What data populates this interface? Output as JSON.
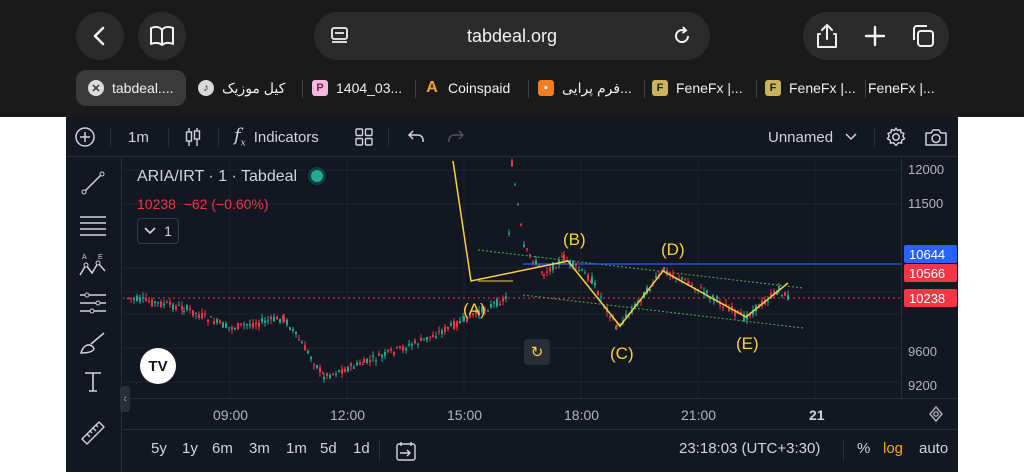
{
  "browser": {
    "url": "tabdeal.org",
    "tabs": [
      {
        "label": "tabdeal....",
        "active": true,
        "icon": "close-icon"
      },
      {
        "label": "کیل موزیک",
        "icon": "music-icon"
      },
      {
        "label": "1404_03...",
        "icon": "p-icon"
      },
      {
        "label": "Coinspaid",
        "icon": "coinspaid-icon"
      },
      {
        "label": "فرم پرایی...",
        "icon": "form-icon"
      },
      {
        "label": "FeneFx |...",
        "icon": "fenefx-icon"
      },
      {
        "label": "FeneFx |...",
        "icon": "fenefx-icon"
      },
      {
        "label": "FeneFx |...",
        "icon": "fenefx-icon"
      }
    ]
  },
  "toolbar": {
    "interval": "1m",
    "indicators": "Indicators",
    "layout_name": "Unnamed"
  },
  "legend": {
    "symbol": "ARIA/IRT · 1 · Tabdeal",
    "last_price": "10238",
    "change": "−62 (−0.60%)",
    "collapse_count": "1"
  },
  "price_axis": {
    "labels": [
      "12000",
      "11500",
      "9600",
      "9200"
    ],
    "tags": [
      {
        "value": "10644",
        "color": "#2962ff"
      },
      {
        "value": "10566",
        "color": "#f23645"
      },
      {
        "value": "10238",
        "color": "#f23645"
      }
    ]
  },
  "time_axis": {
    "labels": [
      "09:00",
      "12:00",
      "15:00",
      "18:00",
      "21:00",
      "21"
    ]
  },
  "waves": [
    "(A)",
    "(B)",
    "(C)",
    "(D)",
    "(E)"
  ],
  "bottom": {
    "ranges": [
      "5y",
      "1y",
      "6m",
      "3m",
      "1m",
      "5d",
      "1d"
    ],
    "clock": "23:18:03 (UTC+3:30)",
    "percent": "%",
    "log": "log",
    "auto": "auto"
  },
  "colors": {
    "up": "#22ab94",
    "down": "#f23645",
    "wave": "#f5d33f",
    "channel": "#4caf50",
    "resistance": "#2962ff"
  }
}
